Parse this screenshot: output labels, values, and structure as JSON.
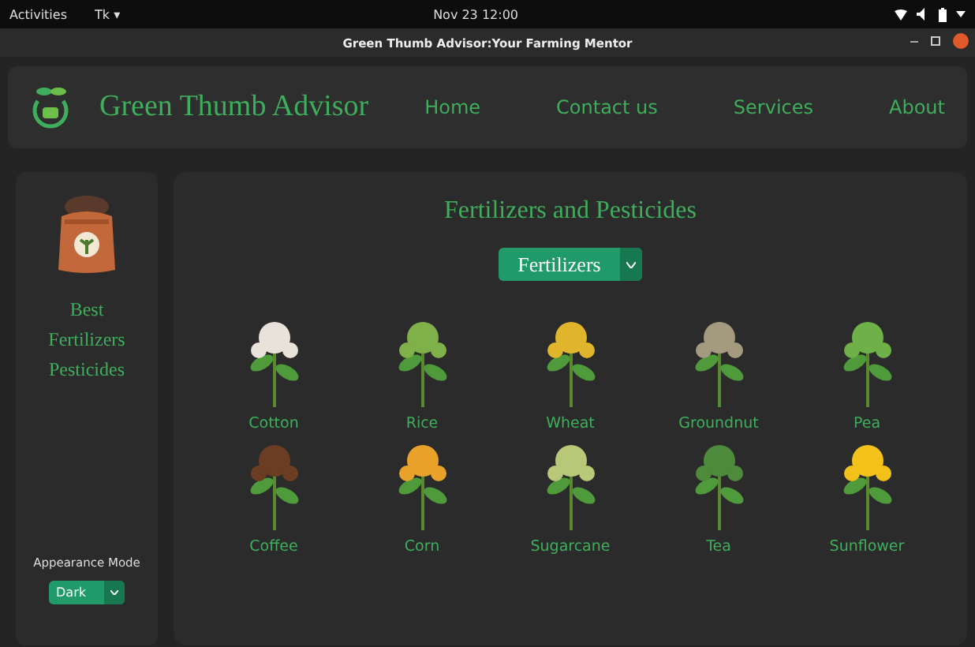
{
  "top_bar": {
    "activities": "Activities",
    "app_menu": "Tk ▾",
    "clock": "Nov 23  12:00"
  },
  "window": {
    "title": "Green Thumb Advisor:Your Farming Mentor"
  },
  "header": {
    "app_name": "Green Thumb Advisor",
    "nav": [
      "Home",
      "Contact us",
      "Services",
      "About"
    ]
  },
  "sidebar": {
    "lines": [
      "Best",
      "Fertilizers",
      "Pesticides"
    ],
    "appearance_label": "Appearance Mode",
    "appearance_value": "Dark"
  },
  "main": {
    "title": "Fertilizers and Pesticides",
    "category_value": "Fertilizers",
    "crops": [
      {
        "name": "Cotton"
      },
      {
        "name": "Rice"
      },
      {
        "name": "Wheat"
      },
      {
        "name": "Groundnut"
      },
      {
        "name": "Pea"
      },
      {
        "name": "Coffee"
      },
      {
        "name": "Corn"
      },
      {
        "name": "Sugarcane"
      },
      {
        "name": "Tea"
      },
      {
        "name": "Sunflower"
      }
    ]
  }
}
